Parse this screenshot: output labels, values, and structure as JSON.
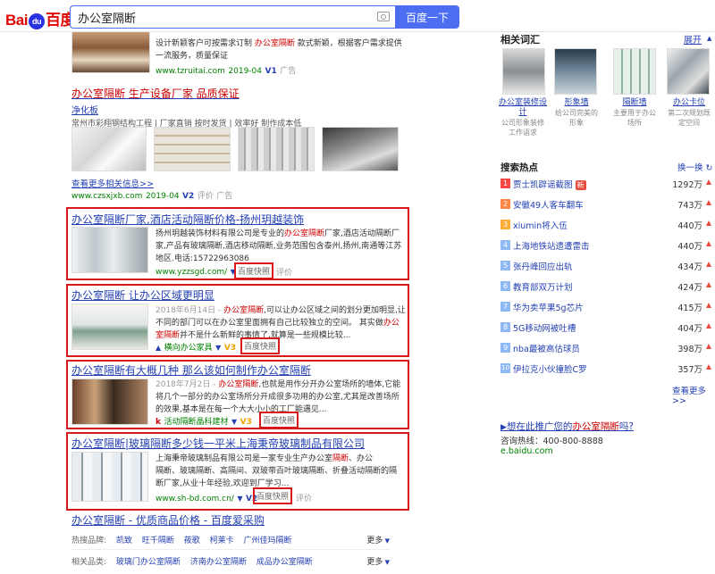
{
  "header": {
    "logo": {
      "left": "Bai",
      "paw": "du",
      "right": "百度"
    },
    "query": "办公室隔断",
    "search_button": "百度一下"
  },
  "top_result": {
    "desc_line1": "设计新颖客户可按需求订制 ",
    "desc_kw": "办公室隔断",
    "desc_line1b": " 款式新颖，根据客户需求提供",
    "desc_line2": "一流服务，质量保证",
    "url": "www.tzruitai.com",
    "date": "2019-04",
    "v": "V1",
    "ad": "广告"
  },
  "result2": {
    "title_kw": "办公室隔断",
    "title_rest": " 生产设备厂家  品质保证",
    "subtitle": "净化板",
    "meta": "常州市彩翔钢结构工程   |   厂家直销 按时发货   |   效率好 制作成本低",
    "more": "查看更多相关信息>>",
    "url": "www.czsxjxb.com",
    "date": "2019-04",
    "v": "V2",
    "eval": "评价",
    "ad": "广告"
  },
  "result3": {
    "title_kw": "办公室隔断",
    "title_rest": "厂家,酒店活动隔断价格-扬州玥越装饰",
    "desc_a": "扬州玥越装饰材料有限公司是专业的",
    "desc_kw": "办公室隔断",
    "desc_b": "厂家,酒店活动隔断厂",
    "desc_line2": "家,产品有玻璃隔断,酒店移动隔断,业务范围包含泰州,扬州,南通等江苏",
    "desc_line3": "地区.电话:15722963086",
    "url": "www.yzzsgd.com/",
    "kuaizhao": "百度快照",
    "eval": "评价"
  },
  "result4": {
    "title_kw": "办公室隔断",
    "title_rest": " 让办公区域更明显",
    "date": "2018年6月14日 - ",
    "desc_kw1": "办公室隔断",
    "desc_a": ",可以让办公区域之间的划分更加明显,让",
    "desc_line2a": "不同的部门可以在办公室里面拥有自己比较独立的空间。 其实做",
    "desc_kw2": "办公",
    "desc_kw3": "室隔断",
    "desc_line3": "并不是什么新鲜的事情了,就算是一些规模比较...",
    "source": "横向办公家具",
    "v": "V3",
    "kuaizhao": "百度快照"
  },
  "result5": {
    "title_kw1": "办公室隔断",
    "title_mid": "有大概几种 那么该如何制作",
    "title_kw2": "办公室隔断",
    "date": "2018年7月2日 - ",
    "desc_kw": "办公室隔断",
    "desc_a": ",也就是用作分开办公室场所的墙体,它能",
    "desc_line2": "将几个一部分的办公室场所分开成很多功用的办公室,尤其是改善场所",
    "desc_line3": "的效果,基本是在每一个大大小小的工厂能遇见...",
    "source": "活动隔断晶科建材",
    "v": "V3",
    "kuaizhao": "百度快照"
  },
  "result6": {
    "title_kw": "办公室隔断",
    "title_rest": "|玻璃隔断多少钱一平米上海秉帝玻璃制品有限公司",
    "desc_a": "上海秉帝玻璃制品有限公司是一家专业生产办公室",
    "desc_kw": "隔断",
    "desc_b": "、办公",
    "desc_line2": "隔断、玻璃隔断、高隔间、双玻带百叶玻璃隔断、折叠活动隔断的隔",
    "desc_line3": "断厂家,从业十年经验,欢迎到厂学习...",
    "url": "www.sh-bd.com.cn/",
    "v": "V2",
    "kuaizhao": "百度快照",
    "eval": "评价"
  },
  "result7": {
    "title_kw": "办公室隔断",
    "title_rest": " - 优质商品价格 - 百度爱采购"
  },
  "hot_brands": {
    "label": "热搜品牌:",
    "items": [
      "凯致",
      "旺千隔断",
      "莜歌",
      "柯莱卡",
      "广州佳玛隔断"
    ],
    "more": "更多"
  },
  "related_categories": {
    "label": "相关品类:",
    "items": [
      "玻璃门办公室隔断",
      "济南办公室隔断",
      "成品办公室隔断"
    ],
    "more": "更多"
  },
  "right": {
    "related_title": "相关词汇",
    "expand": "展开",
    "words": [
      {
        "name": "办公室装修设计",
        "desc": "公司形象装修工作语求"
      },
      {
        "name": "形象墙",
        "desc": "给公司完美的形象"
      },
      {
        "name": "隔断墙",
        "desc": "主要用于办公场所"
      },
      {
        "name": "办公卡位",
        "desc": "第二次规划既定空间"
      }
    ],
    "hot_title": "搜索热点",
    "refresh": "换一换",
    "hot": [
      {
        "rank": "1",
        "name": "贾士凯辟谣截图",
        "new": "新",
        "count": "1292万"
      },
      {
        "rank": "2",
        "name": "安徽49人客车翻车",
        "count": "743万"
      },
      {
        "rank": "3",
        "name": "xiumin将入伍",
        "count": "440万"
      },
      {
        "rank": "4",
        "name": "上海地铁站遗遭雷击",
        "count": "440万"
      },
      {
        "rank": "5",
        "name": "张丹峰回应出轨",
        "count": "434万"
      },
      {
        "rank": "6",
        "name": "教育部双万计划",
        "count": "424万"
      },
      {
        "rank": "7",
        "name": "华为卖苹果5g芯片",
        "count": "415万"
      },
      {
        "rank": "8",
        "name": "5G移动网被吐槽",
        "count": "404万"
      },
      {
        "rank": "9",
        "name": "nba最被高估球员",
        "count": "398万"
      },
      {
        "rank": "10",
        "name": "伊拉克小伙撞脸C罗",
        "count": "357万"
      }
    ],
    "more": "查看更多>>",
    "promo_pre": "想在此推广您的",
    "promo_kw": "办公室隔断",
    "promo_post": "吗?",
    "hotline": "咨询热线：400-800-8888",
    "site": "e.baidu.com"
  },
  "colors": {
    "accent": "#4e6ef2",
    "link": "#2440b3",
    "keyword": "#c00000",
    "url": "#008000",
    "highlight": "#d8191a"
  }
}
